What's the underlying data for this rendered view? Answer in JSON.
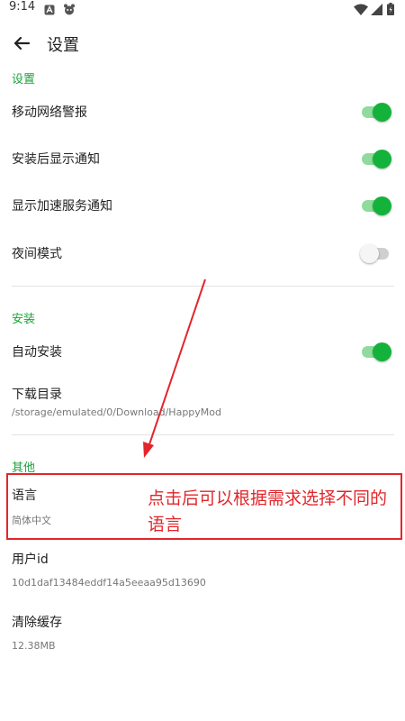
{
  "status_bar": {
    "time": "9:14",
    "icons": [
      "notification-a-icon",
      "bug-icon",
      "wifi-icon",
      "signal-icon",
      "battery-icon"
    ]
  },
  "app_bar": {
    "title": "设置",
    "back_icon": "arrow-left-icon"
  },
  "sections": {
    "general": {
      "header": "设置",
      "mobile_network_alert": {
        "label": "移动网络警报",
        "enabled": true
      },
      "install_notification": {
        "label": "安装后显示通知",
        "enabled": true
      },
      "acceleration_notification": {
        "label": "显示加速服务通知",
        "enabled": true
      },
      "night_mode": {
        "label": "夜间模式",
        "enabled": false
      }
    },
    "install": {
      "header": "安装",
      "auto_install": {
        "label": "自动安装",
        "enabled": true
      },
      "download_dir": {
        "label": "下载目录",
        "value": "/storage/emulated/0/Download/HappyMod"
      }
    },
    "other": {
      "header": "其他",
      "language": {
        "label": "语言",
        "value": "简体中文"
      },
      "user_id": {
        "label": "用户id",
        "value": "10d1daf13484eddf14a5eeaa95d13690"
      },
      "clear_cache": {
        "label": "清除缓存",
        "value": "12.38MB"
      }
    }
  },
  "annotation": {
    "text": "点击后可以根据需求选择不同的语言"
  },
  "colors": {
    "accent": "#1aa33c",
    "switch_on": "#13b33b",
    "annotation": "#e2262b"
  }
}
